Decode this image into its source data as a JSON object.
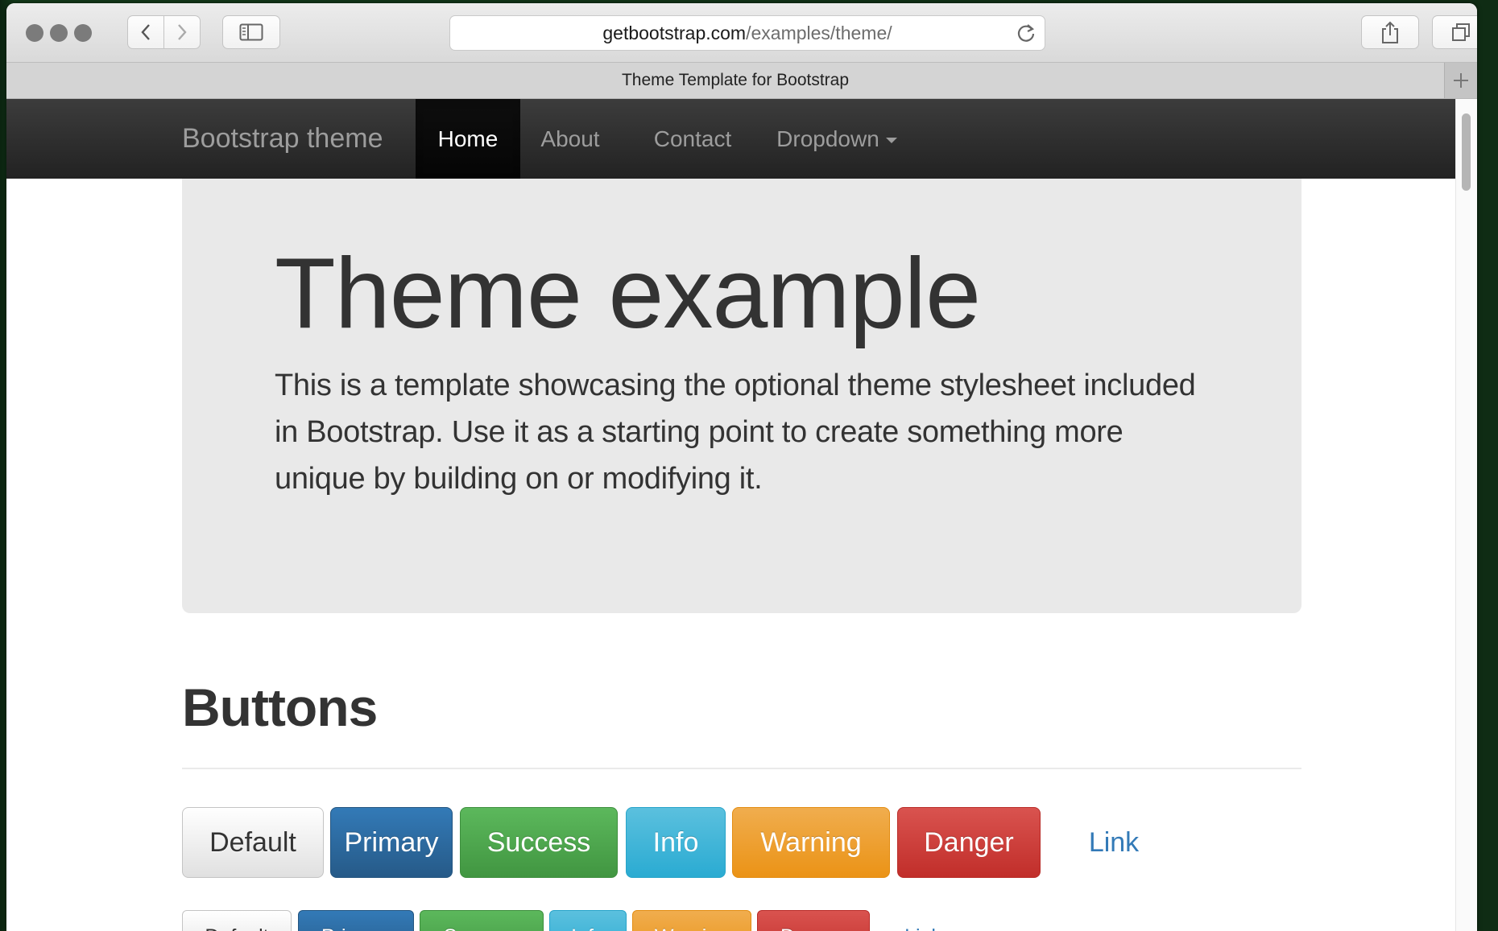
{
  "browser": {
    "url_domain": "getbootstrap.com",
    "url_path": "/examples/theme/",
    "tab_title": "Theme Template for Bootstrap"
  },
  "navbar": {
    "brand": "Bootstrap theme",
    "items": [
      {
        "label": "Home",
        "active": true
      },
      {
        "label": "About"
      },
      {
        "label": "Contact"
      },
      {
        "label": "Dropdown"
      }
    ]
  },
  "jumbotron": {
    "title": "Theme example",
    "text": "This is a template showcasing the optional theme stylesheet included in Bootstrap. Use it as a starting point to create something more unique by building on or modifying it."
  },
  "buttons_section": {
    "title": "Buttons",
    "large": [
      "Default",
      "Primary",
      "Success",
      "Info",
      "Warning",
      "Danger",
      "Link"
    ],
    "default": [
      "Default",
      "Primary",
      "Success",
      "Info",
      "Warning",
      "Danger",
      "Link"
    ]
  },
  "colors": {
    "primary": "#337ab7",
    "success": "#5cb85c",
    "info": "#5bc0de",
    "warning": "#f0ad4e",
    "danger": "#d9534f",
    "navbar": "#222222"
  }
}
